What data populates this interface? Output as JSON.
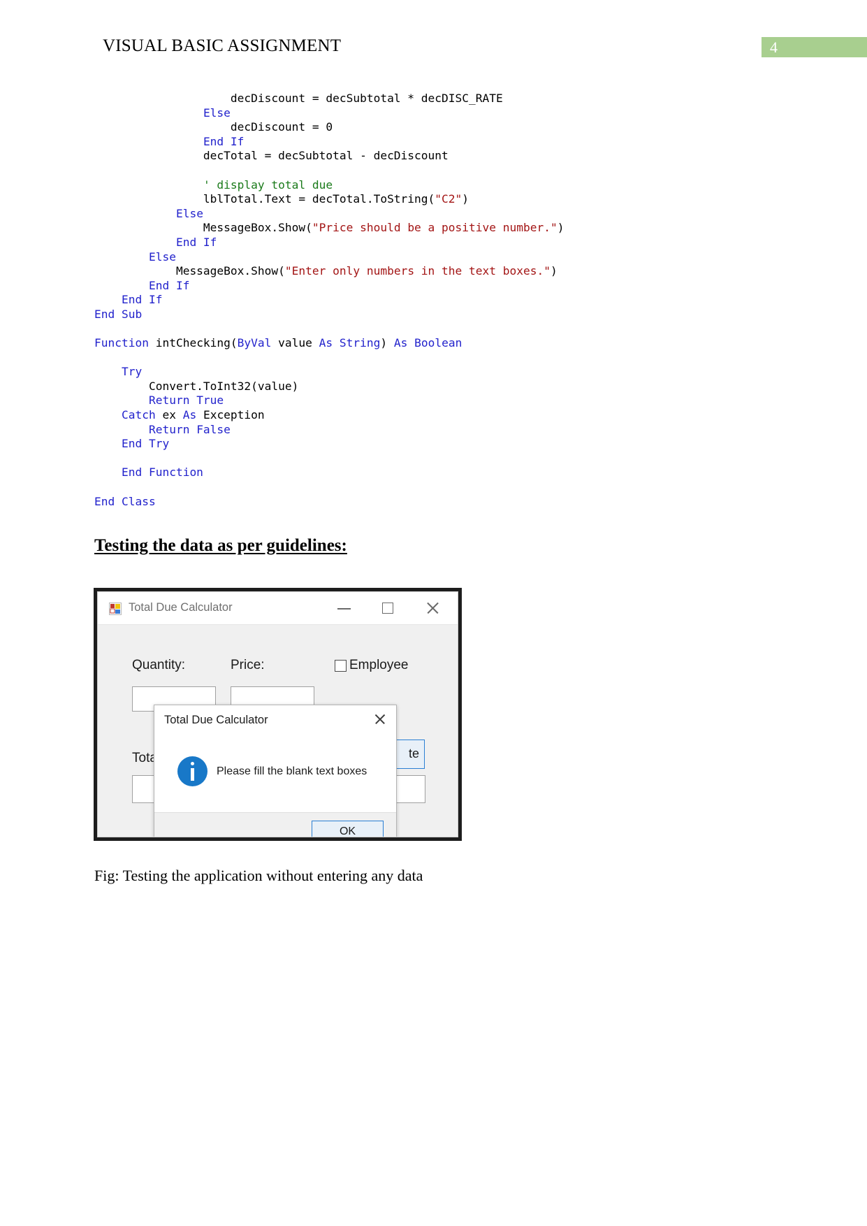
{
  "header": {
    "title": "VISUAL BASIC ASSIGNMENT",
    "page_number": "4",
    "band_color": "#a8cf8f"
  },
  "code": {
    "language": "Visual Basic .NET",
    "colors": {
      "keyword": "#2222cc",
      "string": "#a31515",
      "comment": "#1a7a1a",
      "plain": "#000000"
    },
    "lines": [
      [
        {
          "t": "                    decDiscount = decSubtotal * decDISC_RATE",
          "c": "plain"
        }
      ],
      [
        {
          "t": "                ",
          "c": "plain"
        },
        {
          "t": "Else",
          "c": "kw"
        }
      ],
      [
        {
          "t": "                    decDiscount = 0",
          "c": "plain"
        }
      ],
      [
        {
          "t": "                ",
          "c": "plain"
        },
        {
          "t": "End If",
          "c": "kw"
        }
      ],
      [
        {
          "t": "                decTotal = decSubtotal - decDiscount",
          "c": "plain"
        }
      ],
      [
        {
          "t": "",
          "c": "plain"
        }
      ],
      [
        {
          "t": "                ",
          "c": "plain"
        },
        {
          "t": "' display total due",
          "c": "cmt"
        }
      ],
      [
        {
          "t": "                lblTotal.Text = decTotal.ToString(",
          "c": "plain"
        },
        {
          "t": "\"C2\"",
          "c": "str"
        },
        {
          "t": ")",
          "c": "plain"
        }
      ],
      [
        {
          "t": "            ",
          "c": "plain"
        },
        {
          "t": "Else",
          "c": "kw"
        }
      ],
      [
        {
          "t": "                MessageBox.Show(",
          "c": "plain"
        },
        {
          "t": "\"Price should be a positive number.\"",
          "c": "str"
        },
        {
          "t": ")",
          "c": "plain"
        }
      ],
      [
        {
          "t": "            ",
          "c": "plain"
        },
        {
          "t": "End If",
          "c": "kw"
        }
      ],
      [
        {
          "t": "        ",
          "c": "plain"
        },
        {
          "t": "Else",
          "c": "kw"
        }
      ],
      [
        {
          "t": "            MessageBox.Show(",
          "c": "plain"
        },
        {
          "t": "\"Enter only numbers in the text boxes.\"",
          "c": "str"
        },
        {
          "t": ")",
          "c": "plain"
        }
      ],
      [
        {
          "t": "        ",
          "c": "plain"
        },
        {
          "t": "End If",
          "c": "kw"
        }
      ],
      [
        {
          "t": "    ",
          "c": "plain"
        },
        {
          "t": "End If",
          "c": "kw"
        }
      ],
      [
        {
          "t": "",
          "c": "plain"
        },
        {
          "t": "End Sub",
          "c": "kw"
        }
      ],
      [
        {
          "t": "",
          "c": "plain"
        }
      ],
      [
        {
          "t": "",
          "c": "plain"
        },
        {
          "t": "Function",
          "c": "kw"
        },
        {
          "t": " intChecking(",
          "c": "plain"
        },
        {
          "t": "ByVal",
          "c": "kw"
        },
        {
          "t": " value ",
          "c": "plain"
        },
        {
          "t": "As String",
          "c": "kw"
        },
        {
          "t": ") ",
          "c": "plain"
        },
        {
          "t": "As Boolean",
          "c": "kw"
        }
      ],
      [
        {
          "t": "",
          "c": "plain"
        }
      ],
      [
        {
          "t": "    ",
          "c": "plain"
        },
        {
          "t": "Try",
          "c": "kw"
        }
      ],
      [
        {
          "t": "        Convert.ToInt32(value)",
          "c": "plain"
        }
      ],
      [
        {
          "t": "        ",
          "c": "plain"
        },
        {
          "t": "Return True",
          "c": "kw"
        }
      ],
      [
        {
          "t": "    ",
          "c": "plain"
        },
        {
          "t": "Catch",
          "c": "kw"
        },
        {
          "t": " ex ",
          "c": "plain"
        },
        {
          "t": "As",
          "c": "kw"
        },
        {
          "t": " Exception",
          "c": "plain"
        }
      ],
      [
        {
          "t": "        ",
          "c": "plain"
        },
        {
          "t": "Return False",
          "c": "kw"
        }
      ],
      [
        {
          "t": "    ",
          "c": "plain"
        },
        {
          "t": "End Try",
          "c": "kw"
        }
      ],
      [
        {
          "t": "",
          "c": "plain"
        }
      ],
      [
        {
          "t": "    ",
          "c": "plain"
        },
        {
          "t": "End Function",
          "c": "kw"
        }
      ],
      [
        {
          "t": "",
          "c": "plain"
        }
      ],
      [
        {
          "t": "",
          "c": "plain"
        },
        {
          "t": "End Class",
          "c": "kw"
        }
      ]
    ]
  },
  "section": {
    "heading": "Testing the data as per guidelines:"
  },
  "screenshot": {
    "window": {
      "title": "Total Due Calculator",
      "icon": "vb-form-icon",
      "minimize_label": "minimize",
      "maximize_label": "maximize",
      "close_label": "close"
    },
    "form": {
      "quantity_label": "Quantity:",
      "price_label": "Price:",
      "employee_label": "Employee",
      "total_label": "Total",
      "quantity_value": "",
      "price_value": "",
      "total_value": "",
      "calculate_button": "te",
      "employee_checked": false
    },
    "dialog": {
      "title": "Total Due Calculator",
      "message": "Please fill the blank text boxes",
      "ok_label": "OK",
      "icon": "information-icon",
      "icon_color": "#1878c8",
      "accent_color": "#2a7fd4"
    }
  },
  "caption": {
    "text": "Fig: Testing the application without entering any data"
  }
}
